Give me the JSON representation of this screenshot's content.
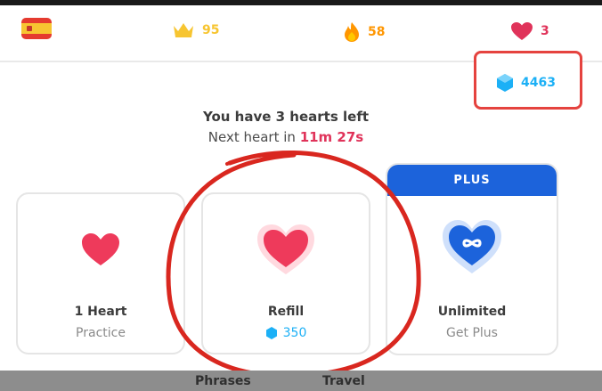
{
  "statusbar": {
    "crowns": "95",
    "streak": "58",
    "hearts": "3",
    "gems": "4463",
    "colors": {
      "crown": "#f7c531",
      "streak": "#ff9600",
      "heart": "#e0335a",
      "gem": "#1cb0f6"
    }
  },
  "message": {
    "line1": "You have 3 hearts left",
    "line2_prefix": "Next heart in",
    "timer": "11m 27s"
  },
  "cards": {
    "practice": {
      "title": "1 Heart",
      "subtitle": "Practice"
    },
    "refill": {
      "title": "Refill",
      "price": "350"
    },
    "unlimited": {
      "badge": "PLUS",
      "title": "Unlimited",
      "subtitle": "Get Plus"
    }
  },
  "bottom_tabs": [
    "Phrases",
    "Travel"
  ],
  "annotation_color": "#d9271f"
}
